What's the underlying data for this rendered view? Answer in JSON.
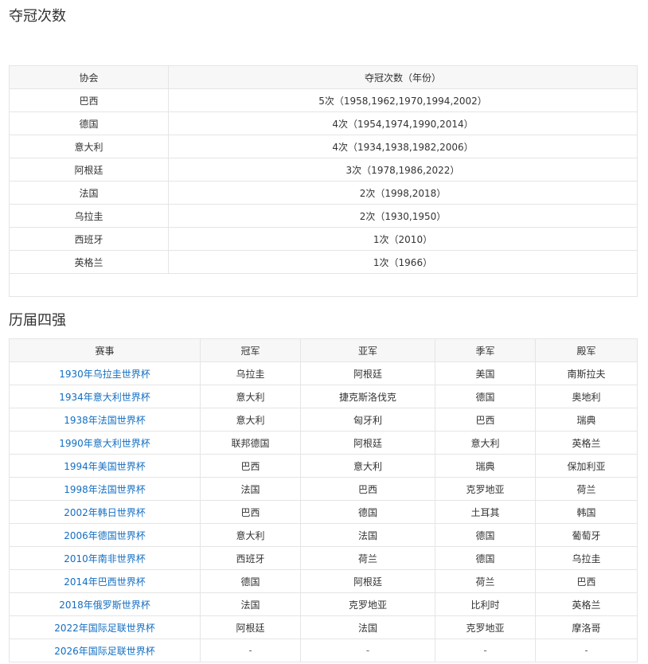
{
  "section1": {
    "title": "夺冠次数",
    "headers": [
      "协会",
      "夺冠次数（年份）"
    ],
    "rows": [
      [
        "巴西",
        "5次（1958,1962,1970,1994,2002）"
      ],
      [
        "德国",
        "4次（1954,1974,1990,2014）"
      ],
      [
        "意大利",
        "4次（1934,1938,1982,2006）"
      ],
      [
        "阿根廷",
        "3次（1978,1986,2022）"
      ],
      [
        "法国",
        "2次（1998,2018）"
      ],
      [
        "乌拉圭",
        "2次（1930,1950）"
      ],
      [
        "西班牙",
        "1次（2010）"
      ],
      [
        "英格兰",
        "1次（1966）"
      ]
    ]
  },
  "section2": {
    "title": "历届四强",
    "headers": [
      "赛事",
      "冠军",
      "亚军",
      "季军",
      "殿军"
    ],
    "rows": [
      [
        "1930年乌拉圭世界杯",
        "乌拉圭",
        "阿根廷",
        "美国",
        "南斯拉夫"
      ],
      [
        "1934年意大利世界杯",
        "意大利",
        "捷克斯洛伐克",
        "德国",
        "奥地利"
      ],
      [
        "1938年法国世界杯",
        "意大利",
        "匈牙利",
        "巴西",
        "瑞典"
      ],
      [
        "1990年意大利世界杯",
        "联邦德国",
        "阿根廷",
        "意大利",
        "英格兰"
      ],
      [
        "1994年美国世界杯",
        "巴西",
        "意大利",
        "瑞典",
        "保加利亚"
      ],
      [
        "1998年法国世界杯",
        "法国",
        "巴西",
        "克罗地亚",
        "荷兰"
      ],
      [
        "2002年韩日世界杯",
        "巴西",
        "德国",
        "土耳其",
        "韩国"
      ],
      [
        "2006年德国世界杯",
        "意大利",
        "法国",
        "德国",
        "葡萄牙"
      ],
      [
        "2010年南非世界杯",
        "西班牙",
        "荷兰",
        "德国",
        "乌拉圭"
      ],
      [
        "2014年巴西世界杯",
        "德国",
        "阿根廷",
        "荷兰",
        "巴西"
      ],
      [
        "2018年俄罗斯世界杯",
        "法国",
        "克罗地亚",
        "比利时",
        "英格兰"
      ],
      [
        "2022年国际足联世界杯",
        "阿根廷",
        "法国",
        "克罗地亚",
        "摩洛哥"
      ],
      [
        "2026年国际足联世界杯",
        "-",
        "-",
        "-",
        "-"
      ]
    ]
  }
}
